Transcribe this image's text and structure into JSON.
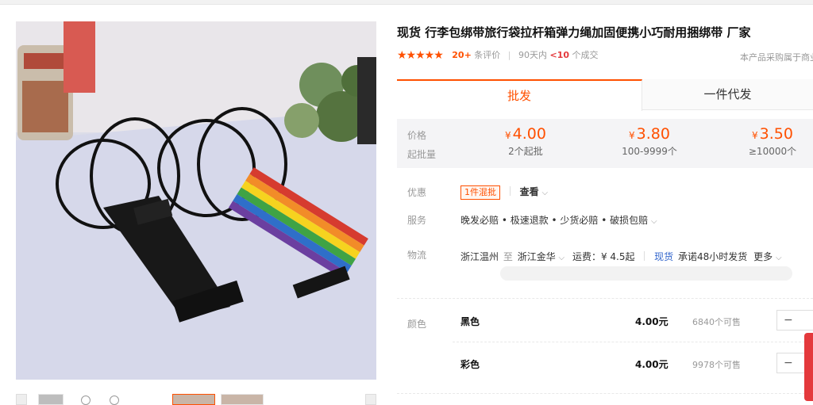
{
  "product": {
    "title": "现货 行李包绑带旅行袋拉杆箱弹力绳加固便携小巧耐用捆绑带 厂家",
    "stars": "★★★★★",
    "review_count": "20+",
    "review_label": "条评价",
    "period_label": "90天内",
    "deal_count": "<10",
    "deal_label": "个成交",
    "note": "本产品采购属于商业"
  },
  "tabs": {
    "wholesale": "批发",
    "dropship": "一件代发"
  },
  "price": {
    "price_label": "价格",
    "moq_label": "起批量",
    "currency": "¥",
    "tiers": [
      {
        "price": "4.00",
        "qty": "2个起批"
      },
      {
        "price": "3.80",
        "qty": "100-9999个"
      },
      {
        "price": "3.50",
        "qty": "≥10000个"
      }
    ]
  },
  "promo": {
    "label": "优惠",
    "badge": "1件混批",
    "view": "查看"
  },
  "service": {
    "label": "服务",
    "text": "晚发必赔 • 极速退款 • 少货必赔 • 破损包赔"
  },
  "logistics": {
    "label": "物流",
    "from": "浙江温州",
    "to_word": "至",
    "to": "浙江金华",
    "fee": "运费：¥ 4.5起",
    "stock": "现货",
    "promise": "承诺48小时发货",
    "more": "更多"
  },
  "color": {
    "label": "颜色",
    "items": [
      {
        "name": "黑色",
        "price": "4.00元",
        "stock": "6840个可售",
        "minus": "−"
      },
      {
        "name": "彩色",
        "price": "4.00元",
        "stock": "9978个可售",
        "minus": "−"
      }
    ]
  },
  "icons": {
    "chevron": "chevron-down-icon",
    "star": "star-icon"
  },
  "accent_color": "#ff5000"
}
